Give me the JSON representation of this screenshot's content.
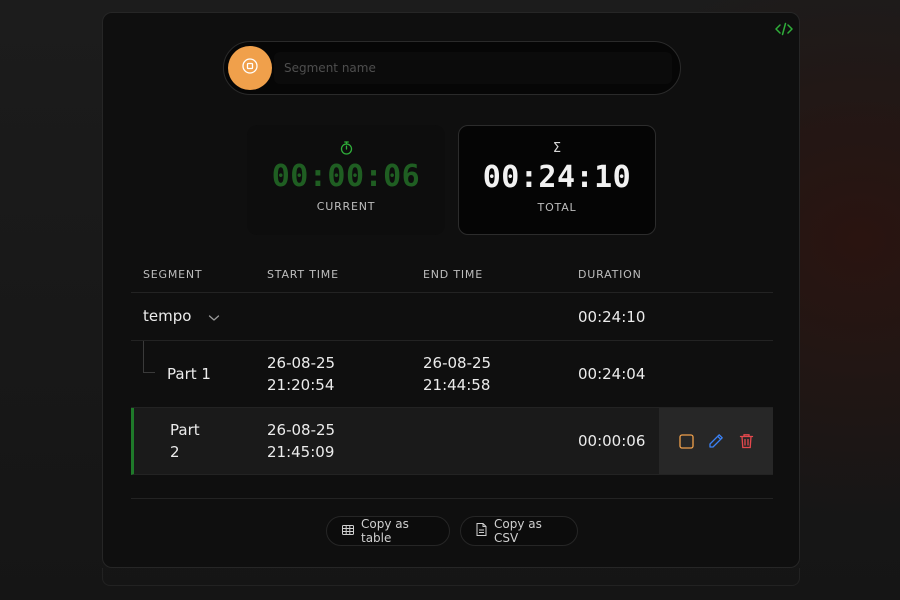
{
  "recorder": {
    "segment_name_placeholder": "Segment name",
    "record_icon": "record-stop-icon",
    "code_icon": "code-icon"
  },
  "timers": {
    "current": {
      "value": "00:00:06",
      "label": "CURRENT",
      "icon": "stopwatch-icon"
    },
    "total": {
      "value": "00:24:10",
      "label": "TOTAL",
      "icon": "Σ"
    }
  },
  "table": {
    "headers": [
      "SEGMENT",
      "START TIME",
      "END TIME",
      "DURATION"
    ],
    "group": {
      "name": "tempo",
      "duration": "00:24:10"
    },
    "rows": [
      {
        "segment": "Part 1",
        "start_date": "26-08-25",
        "start_time": "21:20:54",
        "end_date": "26-08-25",
        "end_time": "21:44:58",
        "duration": "00:24:04"
      },
      {
        "segment_line1": "Part",
        "segment_line2": "2",
        "start_date": "26-08-25",
        "start_time": "21:45:09",
        "end_date": "",
        "end_time": "",
        "duration": "00:00:06"
      }
    ],
    "row_actions": [
      "stop-icon",
      "edit-icon",
      "delete-icon"
    ]
  },
  "footer": {
    "copy_table_label": "Copy as table",
    "copy_csv_label": "Copy as CSV"
  },
  "colors": {
    "accent_orange": "#f0a04b",
    "active_green": "#1f7a2a",
    "edit_blue": "#3b82f6",
    "delete_red": "#e5484d"
  }
}
